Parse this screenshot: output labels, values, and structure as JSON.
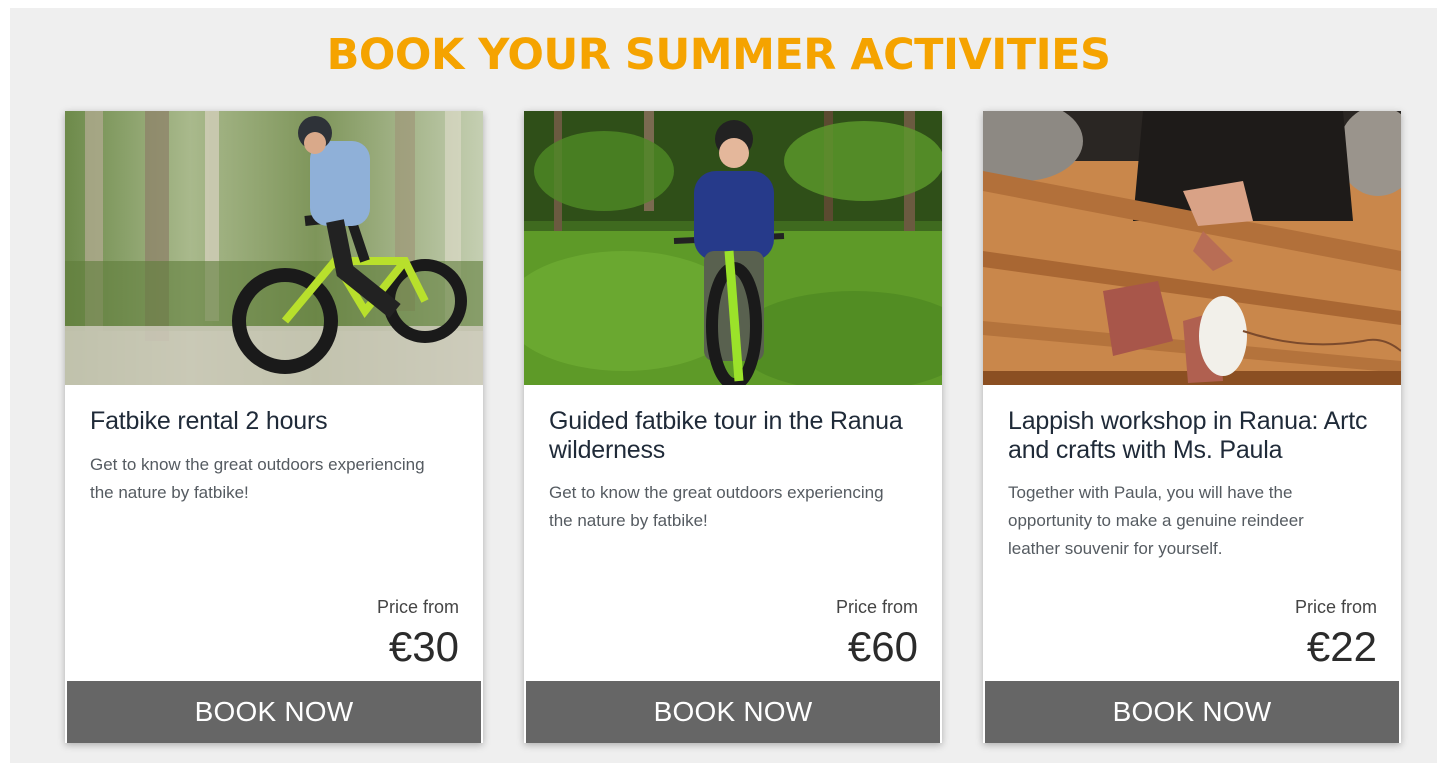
{
  "page": {
    "title": "BOOK YOUR SUMMER ACTIVITIES",
    "accent_color": "#f5a300",
    "button_color": "#666666"
  },
  "cards": [
    {
      "name": "Fatbike rental 2 hours",
      "description": "Get to know the great outdoors experiencing the nature by fatbike!",
      "price_label": "Price from",
      "price": "€30",
      "button_label": "BOOK NOW",
      "image": "fatbike-rider-forest-photo"
    },
    {
      "name": "Guided fatbike tour in the Ranua wilderness",
      "description": "Get to know the great outdoors experiencing the nature by fatbike!",
      "price_label": "Price from",
      "price": "€60",
      "button_label": "BOOK NOW",
      "image": "fatbike-girl-green-forest-photo"
    },
    {
      "name": "Lappish workshop in Ranua: Artc and crafts with Ms. Paula",
      "description": "Together with Paula, you will have the opportunity to make a genuine reindeer leather souvenir for yourself.",
      "price_label": "Price from",
      "price": "€22",
      "button_label": "BOOK NOW",
      "image": "leather-craft-workshop-photo"
    }
  ]
}
